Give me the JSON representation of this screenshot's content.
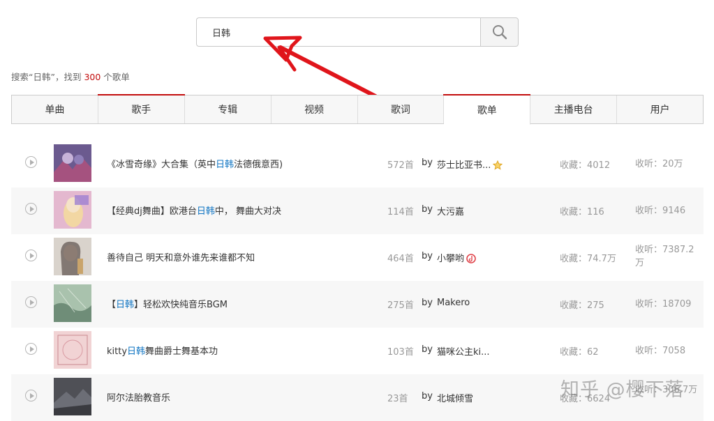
{
  "search": {
    "query": "日韩"
  },
  "summary": {
    "prefix": "搜索“日韩”，找到 ",
    "count": "300",
    "suffix": " 个歌单"
  },
  "tabs": [
    {
      "label": "单曲"
    },
    {
      "label": "歌手"
    },
    {
      "label": "专辑"
    },
    {
      "label": "视频"
    },
    {
      "label": "歌词"
    },
    {
      "label": "歌单"
    },
    {
      "label": "主播电台"
    },
    {
      "label": "用户"
    }
  ],
  "playlists": [
    {
      "title_pre": "《冰雪奇缘》大合集（英中",
      "title_hl": "日韩",
      "title_post": "法德俄意西)",
      "tracks": "572首",
      "by": "by",
      "creator": "莎士比亚书...",
      "badge": "star-badge-icon",
      "collect": "收藏：4012",
      "listen": "收听：20万",
      "cover_color": "#6b5a8f"
    },
    {
      "title_pre": "【经典dj舞曲】欧港台",
      "title_hl": "日韩",
      "title_post": "中， 舞曲大对决",
      "tracks": "114首",
      "by": "by",
      "creator": "大污嘉",
      "badge": "",
      "collect": "收藏：116",
      "listen": "收听：9146",
      "cover_color": "#d59ab8"
    },
    {
      "title_pre": "善待自己 明天和意外谁先来谁都不知",
      "title_hl": "",
      "title_post": "",
      "tracks": "464首",
      "by": "by",
      "creator": "小攀哟",
      "badge": "music-badge-icon",
      "collect": "收藏：74.7万",
      "listen": "收听：7387.2万",
      "cover_color": "#bfb6ae"
    },
    {
      "title_pre": "【",
      "title_hl": "日韩",
      "title_post": "】轻松欢快纯音乐BGM",
      "tracks": "275首",
      "by": "by",
      "creator": "Makero",
      "badge": "",
      "collect": "收藏：275",
      "listen": "收听：18709",
      "cover_color": "#8ea890"
    },
    {
      "title_pre": "kitty",
      "title_hl": "日韩",
      "title_post": "舞曲爵士舞基本功",
      "tracks": "103首",
      "by": "by",
      "creator": "猫咪公主ki...",
      "badge": "",
      "collect": "收藏：62",
      "listen": "收听：7058",
      "cover_color": "#ecc9cc"
    },
    {
      "title_pre": "阿尔法胎教音乐",
      "title_hl": "",
      "title_post": "",
      "tracks": "23首",
      "by": "by",
      "creator": "北城倾雪",
      "badge": "",
      "collect": "收藏：6624",
      "listen": "收听：306.7万",
      "cover_color": "#5a5a5e"
    }
  ],
  "watermark": "知乎 @樱下落",
  "colors": {
    "accent": "#c20c0c",
    "highlight": "#0c73c2",
    "arrow": "#e0151b"
  }
}
